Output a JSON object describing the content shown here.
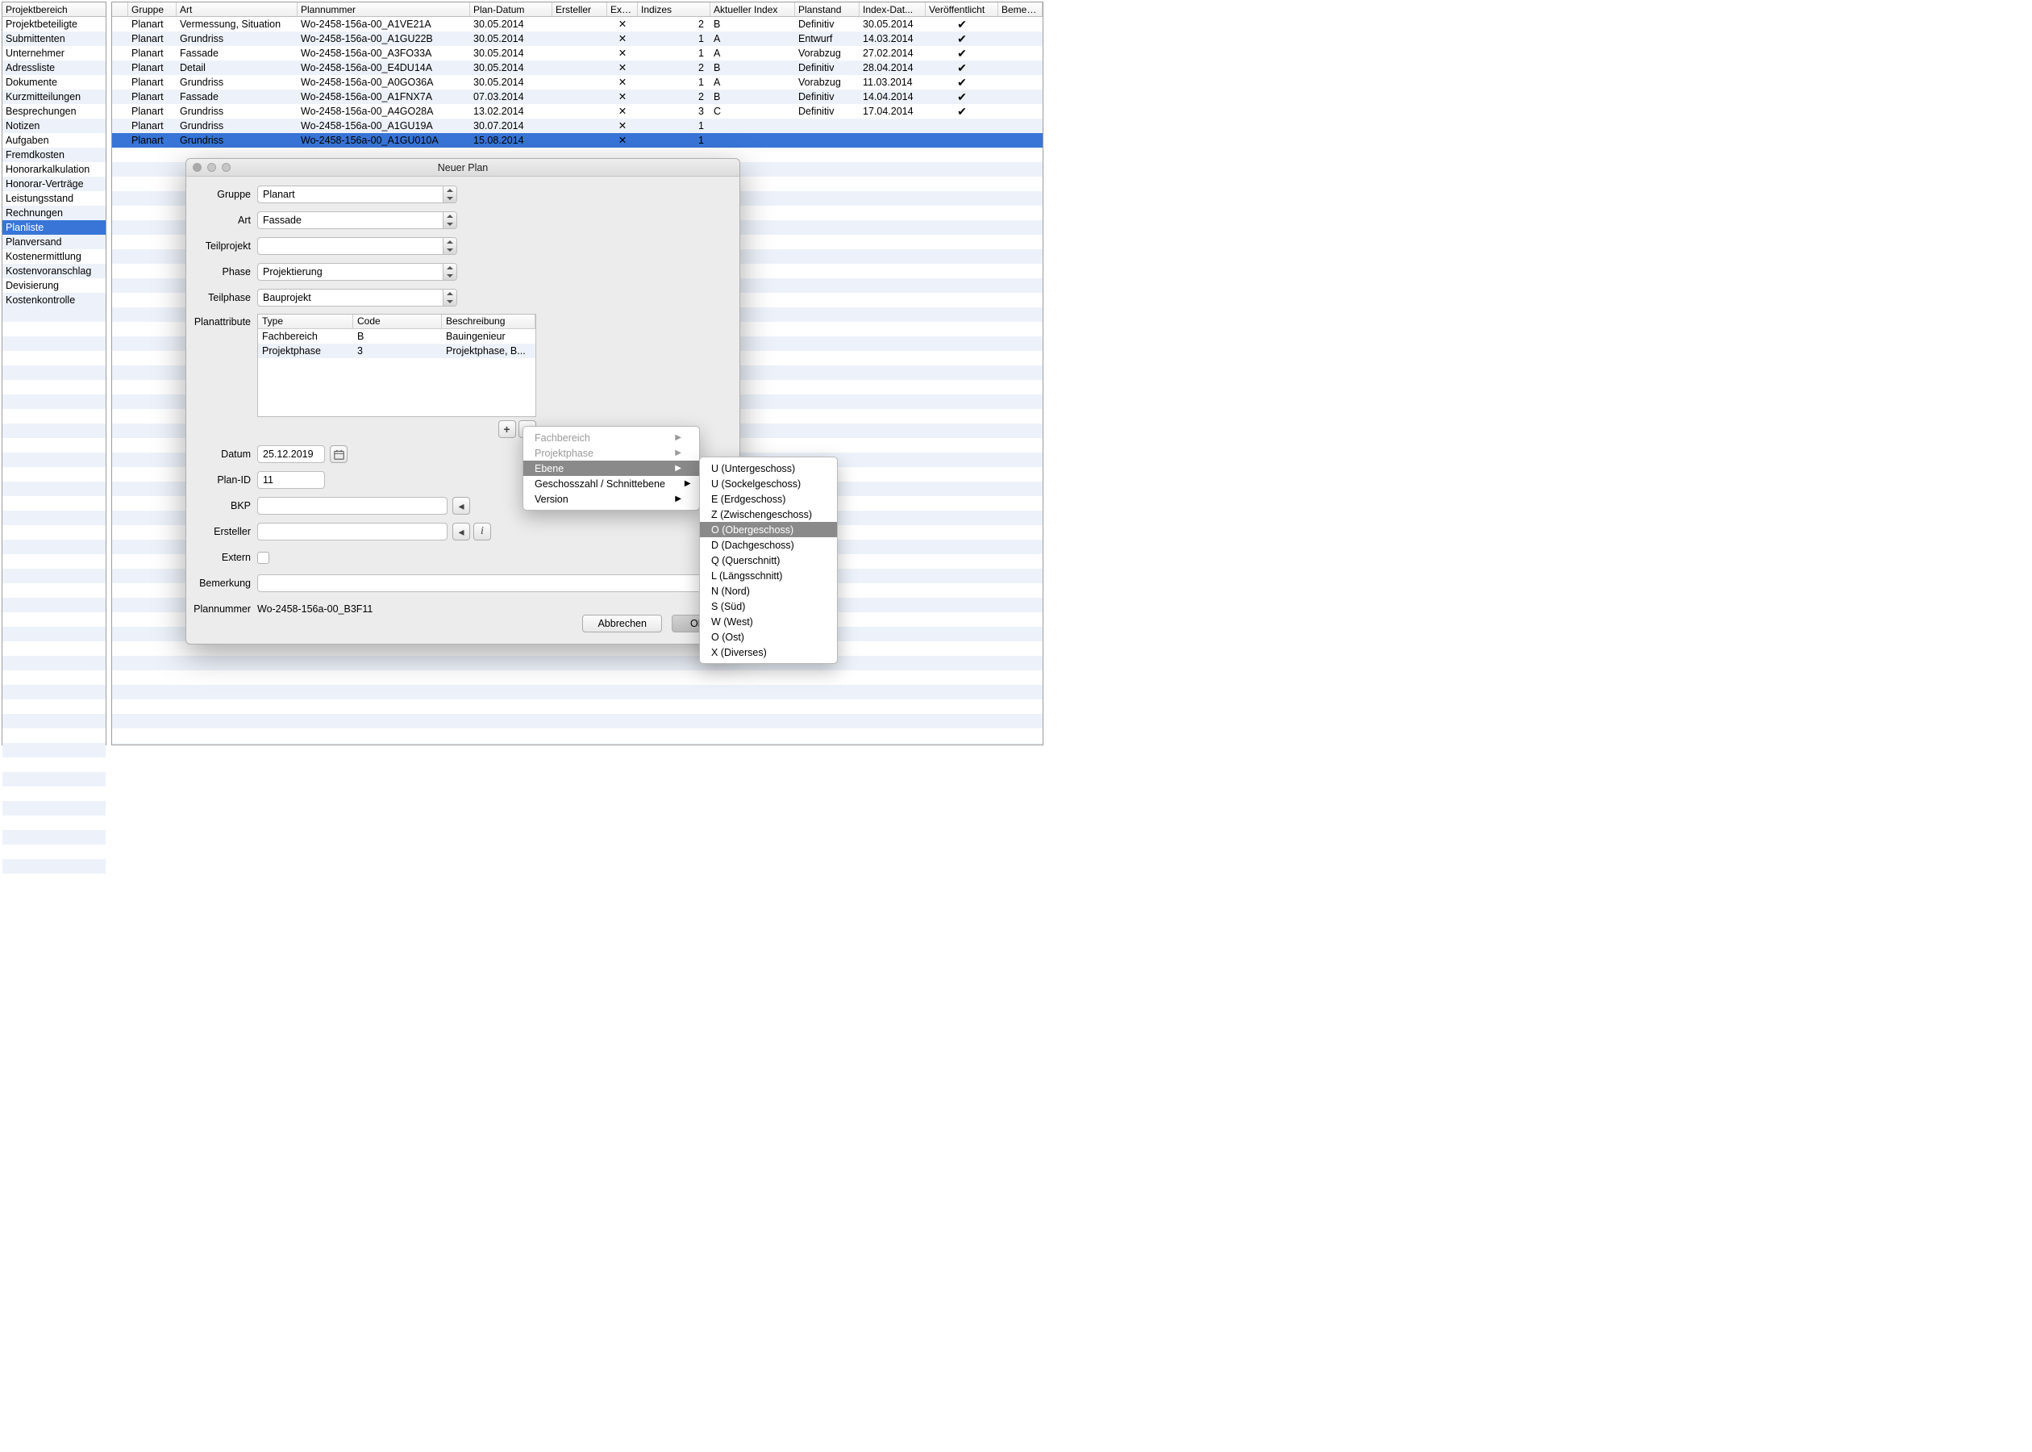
{
  "sidebar": {
    "header": "Projektbereich",
    "selected_index": 14,
    "items": [
      "Projektbeteiligte",
      "Submittenten",
      "Unternehmer",
      "Adressliste",
      "Dokumente",
      "Kurzmitteilungen",
      "Besprechungen",
      "Notizen",
      "Aufgaben",
      "Fremdkosten",
      "Honorarkalkulation",
      "Honorar-Verträge",
      "Leistungsstand",
      "Rechnungen",
      "Planliste",
      "Planversand",
      "Kostenermittlung",
      "Kostenvoranschlag",
      "Devisierung",
      "Kostenkontrolle"
    ]
  },
  "table": {
    "headers": {
      "empty": "",
      "gruppe": "Gruppe",
      "art": "Art",
      "plannummer": "Plannummer",
      "datum": "Plan-Datum",
      "ersteller": "Ersteller",
      "extern": "Extern",
      "indizes": "Indizes",
      "aindex": "Aktueller Index",
      "planstand": "Planstand",
      "idatum": "Index-Dat...",
      "pub": "Veröffentlicht",
      "bemerkung": "Bemerkung"
    },
    "selected_index": 8,
    "rows": [
      {
        "gruppe": "Planart",
        "art": "Vermessung, Situation",
        "pn": "Wo-2458-156a-00_A1VE21A",
        "datum": "30.05.2014",
        "ext": "✕",
        "idz": "2",
        "ai": "B",
        "ps": "Definitiv",
        "id": "30.05.2014",
        "pub": "✔"
      },
      {
        "gruppe": "Planart",
        "art": "Grundriss",
        "pn": "Wo-2458-156a-00_A1GU22B",
        "datum": "30.05.2014",
        "ext": "✕",
        "idz": "1",
        "ai": "A",
        "ps": "Entwurf",
        "id": "14.03.2014",
        "pub": "✔"
      },
      {
        "gruppe": "Planart",
        "art": "Fassade",
        "pn": "Wo-2458-156a-00_A3FO33A",
        "datum": "30.05.2014",
        "ext": "✕",
        "idz": "1",
        "ai": "A",
        "ps": "Vorabzug",
        "id": "27.02.2014",
        "pub": "✔"
      },
      {
        "gruppe": "Planart",
        "art": "Detail",
        "pn": "Wo-2458-156a-00_E4DU14A",
        "datum": "30.05.2014",
        "ext": "✕",
        "idz": "2",
        "ai": "B",
        "ps": "Definitiv",
        "id": "28.04.2014",
        "pub": "✔"
      },
      {
        "gruppe": "Planart",
        "art": "Grundriss",
        "pn": "Wo-2458-156a-00_A0GO36A",
        "datum": "30.05.2014",
        "ext": "✕",
        "idz": "1",
        "ai": "A",
        "ps": "Vorabzug",
        "id": "11.03.2014",
        "pub": "✔"
      },
      {
        "gruppe": "Planart",
        "art": "Fassade",
        "pn": "Wo-2458-156a-00_A1FNX7A",
        "datum": "07.03.2014",
        "ext": "✕",
        "idz": "2",
        "ai": "B",
        "ps": "Definitiv",
        "id": "14.04.2014",
        "pub": "✔"
      },
      {
        "gruppe": "Planart",
        "art": "Grundriss",
        "pn": "Wo-2458-156a-00_A4GO28A",
        "datum": "13.02.2014",
        "ext": "✕",
        "idz": "3",
        "ai": "C",
        "ps": "Definitiv",
        "id": "17.04.2014",
        "pub": "✔"
      },
      {
        "gruppe": "Planart",
        "art": "Grundriss",
        "pn": "Wo-2458-156a-00_A1GU19A",
        "datum": "30.07.2014",
        "ext": "✕",
        "idz": "1",
        "ai": "",
        "ps": "",
        "id": "",
        "pub": ""
      },
      {
        "gruppe": "Planart",
        "art": "Grundriss",
        "pn": "Wo-2458-156a-00_A1GU010A",
        "datum": "15.08.2014",
        "ext": "✕",
        "idz": "1",
        "ai": "",
        "ps": "",
        "id": "",
        "pub": ""
      }
    ]
  },
  "dialog": {
    "title": "Neuer Plan",
    "labels": {
      "gruppe": "Gruppe",
      "art": "Art",
      "teilprojekt": "Teilprojekt",
      "phase": "Phase",
      "teilphase": "Teilphase",
      "planattribute": "Planattribute",
      "datum": "Datum",
      "planid": "Plan-ID",
      "bkp": "BKP",
      "ersteller": "Ersteller",
      "extern": "Extern",
      "bemerkung": "Bemerkung",
      "plannummer": "Plannummer"
    },
    "values": {
      "gruppe": "Planart",
      "art": "Fassade",
      "teilprojekt": "",
      "phase": "Projektierung",
      "teilphase": "Bauprojekt",
      "datum": "25.12.2019",
      "planid": "11",
      "bkp": "",
      "ersteller": "",
      "bemerkung": "",
      "plannummer": "Wo-2458-156a-00_B3F11"
    },
    "attr_table": {
      "headers": {
        "type": "Type",
        "code": "Code",
        "desc": "Beschreibung"
      },
      "rows": [
        {
          "type": "Fachbereich",
          "code": "B",
          "desc": "Bauingenieur"
        },
        {
          "type": "Projektphase",
          "code": "3",
          "desc": "Projektphase, B..."
        }
      ]
    },
    "buttons": {
      "plus": "+",
      "minus": "−",
      "cal": "📅",
      "left": "◂",
      "info": "i",
      "cancel": "Abbrechen",
      "ok": "OK"
    }
  },
  "context_menu": {
    "selected_index": 2,
    "items": [
      {
        "label": "Fachbereich",
        "disabled": true,
        "arrow": true
      },
      {
        "label": "Projektphase",
        "disabled": true,
        "arrow": true
      },
      {
        "label": "Ebene",
        "disabled": false,
        "arrow": true
      },
      {
        "label": "Geschosszahl / Schnittebene",
        "disabled": false,
        "arrow": true
      },
      {
        "label": "Version",
        "disabled": false,
        "arrow": true
      }
    ]
  },
  "submenu": {
    "selected_index": 4,
    "items": [
      "U (Untergeschoss)",
      "U (Sockelgeschoss)",
      "E (Erdgeschoss)",
      "Z (Zwischengeschoss)",
      "O (Obergeschoss)",
      "D (Dachgeschoss)",
      "Q (Querschnitt)",
      "L (Längsschnitt)",
      "N (Nord)",
      "S (Süd)",
      "W (West)",
      "O (Ost)",
      "X (Diverses)"
    ]
  }
}
